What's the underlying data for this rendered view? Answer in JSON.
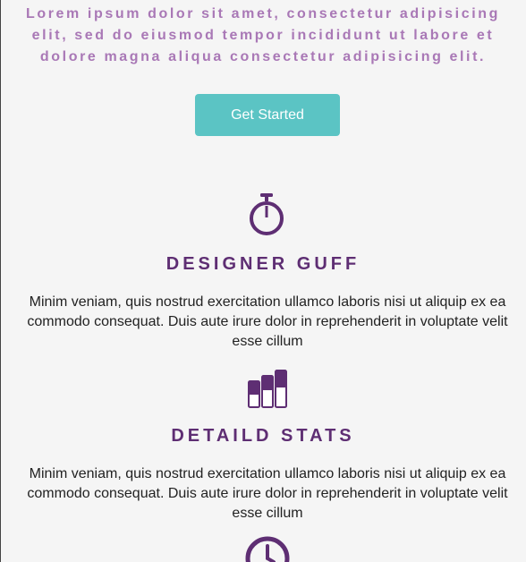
{
  "intro": {
    "text": "Lorem ipsum dolor sit amet, consectetur adipisicing elit, sed do eiusmod tempor incididunt ut labore et dolore magna aliqua consectetur adipisicing elit."
  },
  "cta": {
    "label": "Get Started"
  },
  "colors": {
    "accent": "#5bc4c4",
    "brand_purple": "#5e2e73",
    "intro_text": "#a978b6",
    "background": "#f5f5f5"
  },
  "features": [
    {
      "icon": "stopwatch-icon",
      "title": "DESIGNER GUFF",
      "text": "Minim veniam, quis nostrud exercitation ullamco laboris nisi ut aliquip ex ea commodo consequat. Duis aute irure dolor in reprehenderit in voluptate velit esse cillum"
    },
    {
      "icon": "stats-bars-icon",
      "title": "DETAILD STATS",
      "text": "Minim veniam, quis nostrud exercitation ullamco laboris nisi ut aliquip ex ea commodo consequat. Duis aute irure dolor in reprehenderit in voluptate velit esse cillum"
    },
    {
      "icon": "clock-icon"
    }
  ]
}
